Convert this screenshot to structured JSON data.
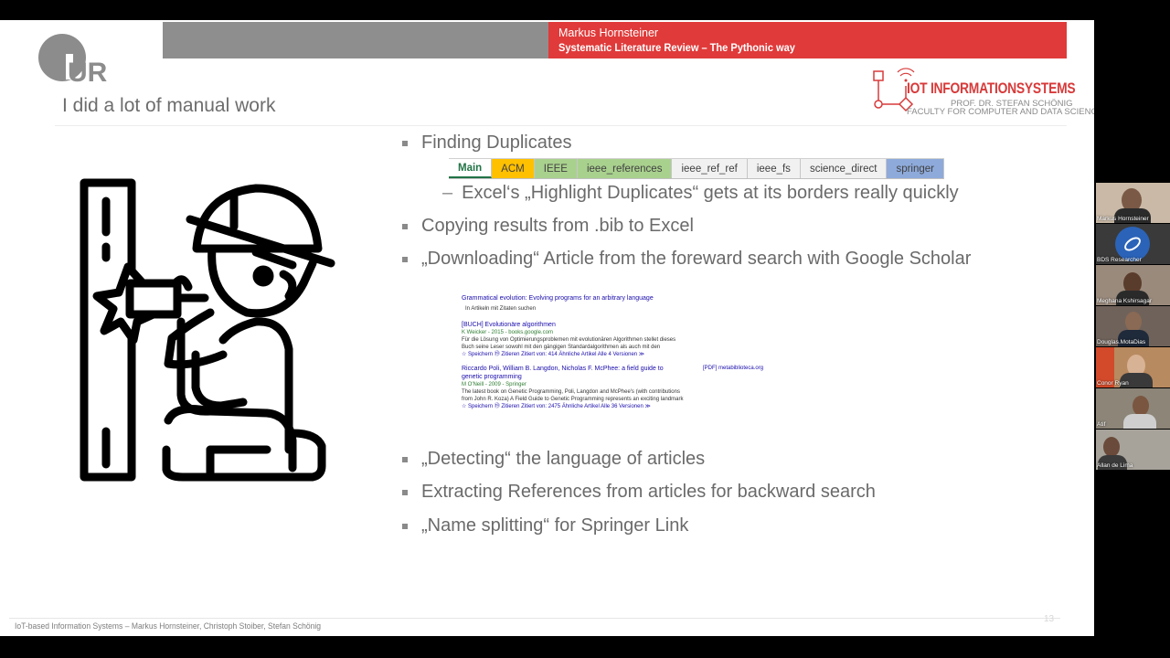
{
  "header": {
    "presenter": "Markus Hornsteiner",
    "talk_title": "Systematic Literature Review – The Pythonic way",
    "university_logo_text": "UR",
    "iot_logo_title": "IOT INFORMATIONSYSTEMS",
    "iot_logo_prof": "PROF. DR. STEFAN SCHÖNIG",
    "iot_logo_faculty": "FACULTY FOR COMPUTER AND DATA SCIENCE"
  },
  "slide": {
    "title": "I did a lot of manual work",
    "bullets": [
      "Finding Duplicates",
      "Copying results from .bib to Excel",
      "„Downloading“ Article from the foreward search with Google Scholar",
      "„Detecting“ the language of articles",
      "Extracting References from articles for backward search",
      "„Name splitting“ for Springer Link"
    ],
    "sub_bullet": "Excel‘s „Highlight Duplicates“ gets at its borders really quickly",
    "sheet_tabs": [
      "Main",
      "ACM",
      "IEEE",
      "ieee_references",
      "ieee_ref_ref",
      "ieee_fs",
      "science_direct",
      "springer"
    ],
    "scholar": {
      "top_title": "Grammatical evolution: Evolving programs for an arbitrary language",
      "top_check": "In Artikeln mit Zitaten suchen",
      "r1_tag": "[BUCH]",
      "r1_title": "Evolutionäre algorithmen",
      "r1_meta": "K Weicker - 2015 - books.google.com",
      "r1_snip1": "Für die Lösung von Optimierungsproblemen mit evolutionären Algorithmen stellet dieses",
      "r1_snip2": "Buch seine Leser sowohl mit den gängigen Standardalgorithmen als auch mit den",
      "r1_links": "☆ Speichern   ⑲ Zitieren   Zitiert von: 414   Ähnliche Artikel   Alle 4 Versionen   ≫",
      "r2_title": "Riccardo Poli, William B. Langdon, Nicholas F. McPhee: a field guide to genetic programming",
      "r2_side": "[PDF] metabiblioteca.org",
      "r2_meta": "M O'Neill - 2009 - Springer",
      "r2_snip1": "The latest book on Genetic Programming, Poli, Langdon and McPhee's (with contributions",
      "r2_snip2": "from John R. Koza) A Field Guide to Genetic Programming represents an exciting landmark",
      "r2_links": "☆ Speichern   ⑲ Zitieren   Zitiert von: 2475   Ähnliche Artikel   Alle 36 Versionen   ≫"
    },
    "footer": "IoT-based Information Systems – Markus Hornsteiner, Christoph Stoiber, Stefan Schönig",
    "page_number": "13"
  },
  "participants": [
    {
      "name": "Markus Hornsteiner",
      "bg": "#c9b9a6"
    },
    {
      "name": "BDS Researcher",
      "bg": "#3a3a3a"
    },
    {
      "name": "Meghana Kshirsagar",
      "bg": "#9a8a7c"
    },
    {
      "name": "Douglas.MotaDias",
      "bg": "#6f625a"
    },
    {
      "name": "Conor Ryan",
      "bg": "#b88a60"
    },
    {
      "name": "Atif",
      "bg": "#8c8578"
    },
    {
      "name": "Allan de Lima",
      "bg": "#a7a39a"
    }
  ],
  "colors": {
    "red_bar": "#e03a3a",
    "grey_bar": "#8e8e8e",
    "excel_green": "#217346",
    "tab_orange": "#ffc000",
    "tab_green": "#a9d18e",
    "tab_blue": "#8eaadb"
  }
}
